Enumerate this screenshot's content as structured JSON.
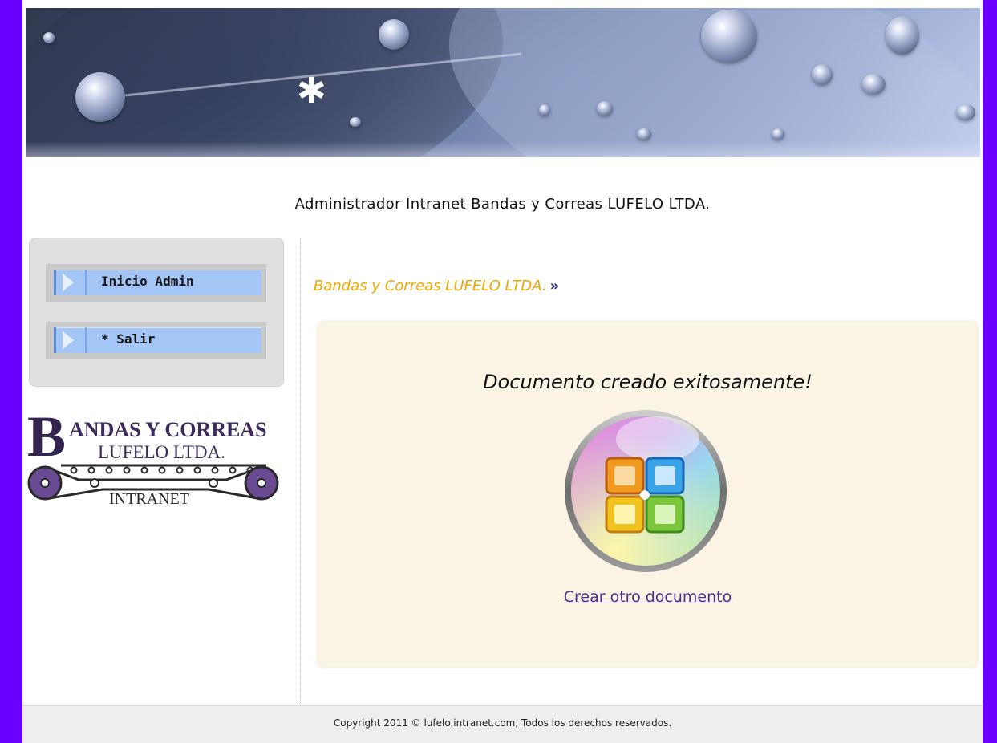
{
  "header": {
    "site_title": "Administrador Intranet Bandas y Correas LUFELO LTDA."
  },
  "sidebar": {
    "items": [
      {
        "label": "Inicio Admin"
      },
      {
        "label": "* Salir"
      }
    ],
    "logo": {
      "line1": "BANDAS Y CORREAS",
      "line2": "LUFELO LTDA.",
      "line3": "INTRANET"
    }
  },
  "main": {
    "breadcrumb": "Bandas y Correas LUFELO LTDA.",
    "success_message": "Documento creado exitosamente!",
    "create_link": "Crear otro documento"
  },
  "footer": {
    "copyright": "Copyright 2011 © lufelo.intranet.com, Todos los derechos reservados."
  },
  "colors": {
    "frame": "#6a00ff",
    "nav_button": "#a4c6f7",
    "breadcrumb": "#f0a800",
    "content_panel": "#fbf4e5",
    "link": "#4a2e8d"
  },
  "icons": {
    "banner": "water-drops-leaf-image",
    "nav_arrow": "arrow-right-icon",
    "breadcrumb_arrow": "double-chevron-right-icon",
    "office": "microsoft-office-icon"
  }
}
